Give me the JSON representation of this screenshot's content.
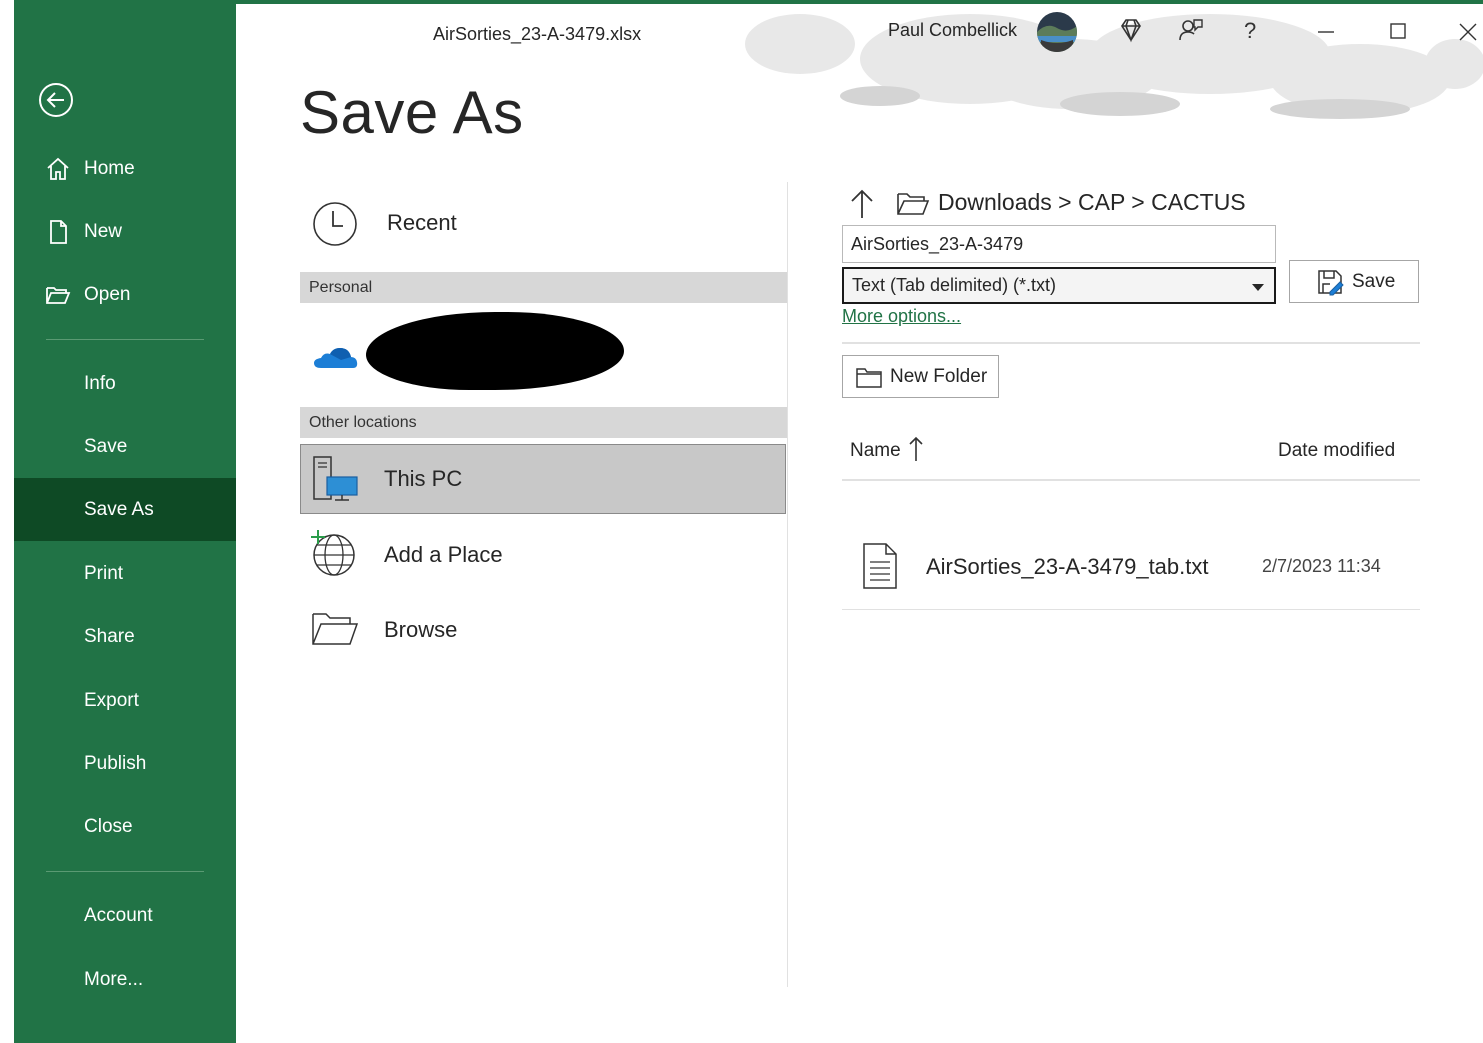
{
  "window": {
    "file_name": "AirSorties_23-A-3479.xlsx",
    "user_name": "Paul Combellick",
    "help": "?"
  },
  "sidebar": {
    "items": [
      {
        "label": "Home",
        "icon": "home-icon"
      },
      {
        "label": "New",
        "icon": "new-document-icon"
      },
      {
        "label": "Open",
        "icon": "open-folder-icon"
      },
      {
        "label": "Info"
      },
      {
        "label": "Save"
      },
      {
        "label": "Save As",
        "active": true
      },
      {
        "label": "Print"
      },
      {
        "label": "Share"
      },
      {
        "label": "Export"
      },
      {
        "label": "Publish"
      },
      {
        "label": "Close"
      },
      {
        "label": "Account"
      },
      {
        "label": "More..."
      }
    ]
  },
  "page": {
    "title": "Save As"
  },
  "locations": {
    "recent": "Recent",
    "personal_header": "Personal",
    "other_header": "Other locations",
    "this_pc": "This PC",
    "add_place": "Add a Place",
    "browse": "Browse"
  },
  "save_panel": {
    "breadcrumb": "Downloads > CAP > CACTUS",
    "filename_value": "AirSorties_23-A-3479",
    "filetype_value": "Text (Tab delimited) (*.txt)",
    "save_label": "Save",
    "more_options": "More options...",
    "new_folder": "New Folder",
    "col_name": "Name",
    "col_date": "Date modified",
    "files": [
      {
        "name": "AirSorties_23-A-3479_tab.txt",
        "date": "2/7/2023 11:34"
      }
    ]
  },
  "colors": {
    "accent": "#217346",
    "active": "#0e4a25",
    "selected_location": "#c8c8c8"
  }
}
